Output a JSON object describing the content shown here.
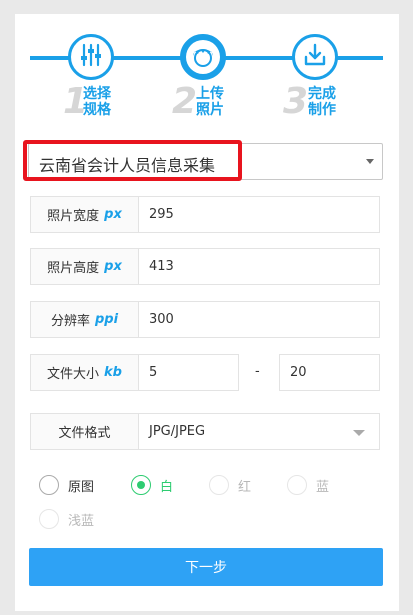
{
  "steps": [
    {
      "num": "1",
      "label": "选择规格",
      "icon": "sliders-icon"
    },
    {
      "num": "2",
      "label": "上传照片",
      "icon": "portrait-icon"
    },
    {
      "num": "3",
      "label": "完成制作",
      "icon": "download-icon"
    }
  ],
  "template_select": {
    "value": "云南省会计人员信息采集"
  },
  "fields": {
    "width": {
      "label": "照片宽度",
      "unit": "px",
      "value": "295"
    },
    "height": {
      "label": "照片高度",
      "unit": "px",
      "value": "413"
    },
    "dpi": {
      "label": "分辨率",
      "unit": "ppi",
      "value": "300"
    },
    "filesize": {
      "label": "文件大小",
      "unit": "kb",
      "min": "5",
      "separator": "-",
      "max": "20"
    },
    "format": {
      "label": "文件格式",
      "value": "JPG/JPEG"
    }
  },
  "background_options": [
    {
      "label": "原图",
      "state": "enabled"
    },
    {
      "label": "白",
      "state": "checked"
    },
    {
      "label": "红",
      "state": "disabled"
    },
    {
      "label": "蓝",
      "state": "disabled"
    },
    {
      "label": "浅蓝",
      "state": "disabled"
    }
  ],
  "next_button": {
    "label": "下一步"
  },
  "colors": {
    "accent": "#1aa0e8",
    "button": "#2ea2f5",
    "highlight": "#e8141e",
    "checked": "#2ecc71"
  }
}
